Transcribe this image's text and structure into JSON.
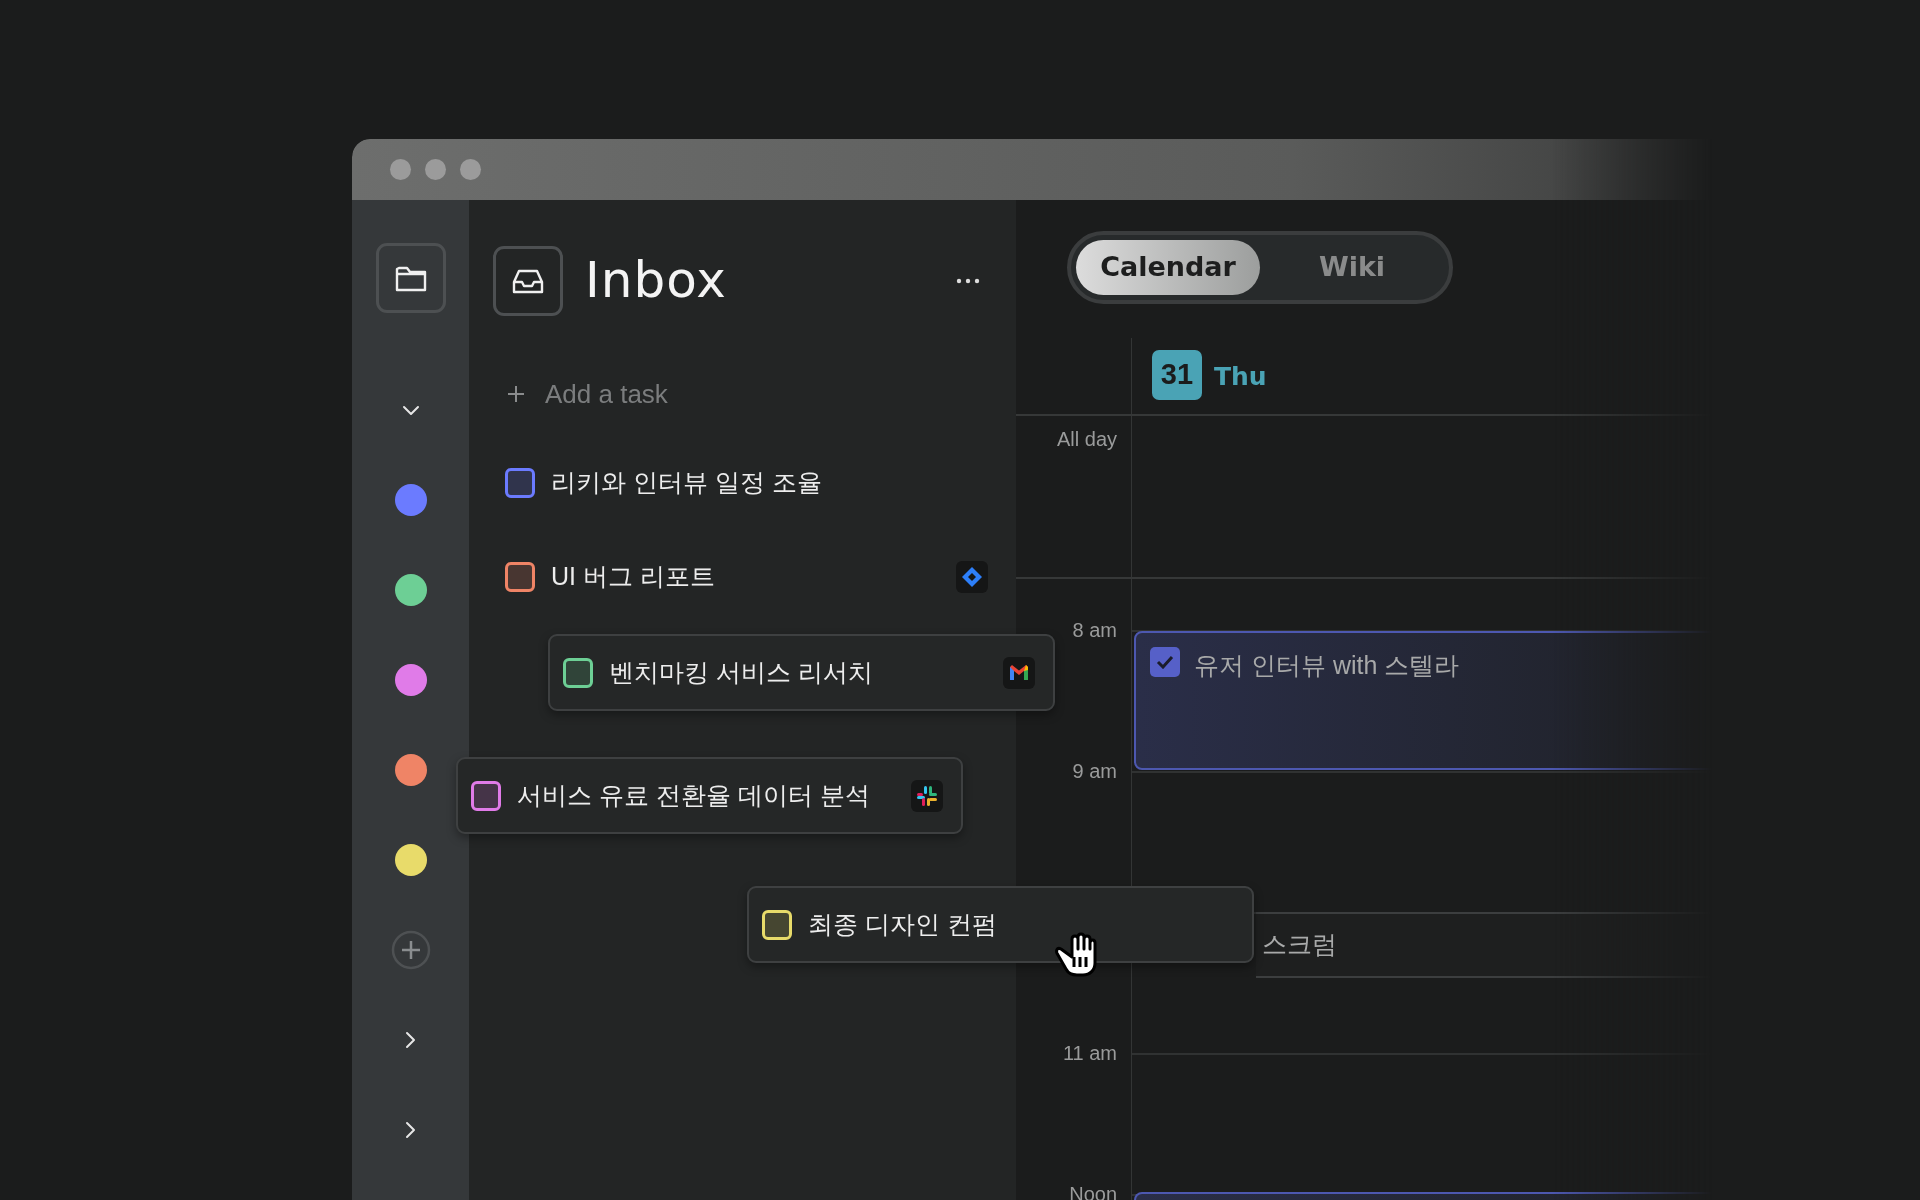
{
  "sidebar": {
    "projects": [
      {
        "color": "#6b7bff"
      },
      {
        "color": "#6dcf95"
      },
      {
        "color": "#e07be8"
      },
      {
        "color": "#ef8466"
      },
      {
        "color": "#e8db6a"
      }
    ]
  },
  "inbox": {
    "title": "Inbox",
    "add_task": {
      "placeholder": "Add a task"
    },
    "tasks": [
      {
        "label": "리키와 인터뷰 일정 조율",
        "color": "#6b7bff",
        "checked": false,
        "dragged": false
      },
      {
        "label": "UI 버그 리포트",
        "color": "#ef8466",
        "checked": false,
        "dragged": false,
        "source": {
          "kind": "diamond"
        }
      },
      {
        "label": "벤치마킹 서비스 리서치",
        "color": "#6dcf95",
        "checked": false,
        "dragged": true,
        "source": {
          "kind": "mail"
        }
      },
      {
        "label": "서비스 유료 전환율 데이터 분석",
        "color": "#e07be8",
        "checked": false,
        "dragged": true,
        "source": {
          "kind": "pinwheel"
        }
      },
      {
        "label": "최종 디자인 컨펌",
        "color": "#e8db6a",
        "checked": false,
        "dragged": true
      }
    ]
  },
  "calendar": {
    "view_tabs": [
      {
        "label": "Calendar",
        "selected": true
      },
      {
        "label": "Wiki",
        "selected": false
      }
    ],
    "day": {
      "number": "31",
      "weekday": "Thu"
    },
    "all_day_label": "All day",
    "time_labels": [
      "8 am",
      "9 am",
      "11 am",
      "Noon"
    ],
    "events": [
      {
        "title": "유저 인터뷰 with 스텔라",
        "checked": true,
        "color": "#4d58b0"
      },
      {
        "title": "스크럼",
        "color": "#3c3e3f"
      },
      {
        "color": "#4d58b0"
      }
    ]
  }
}
